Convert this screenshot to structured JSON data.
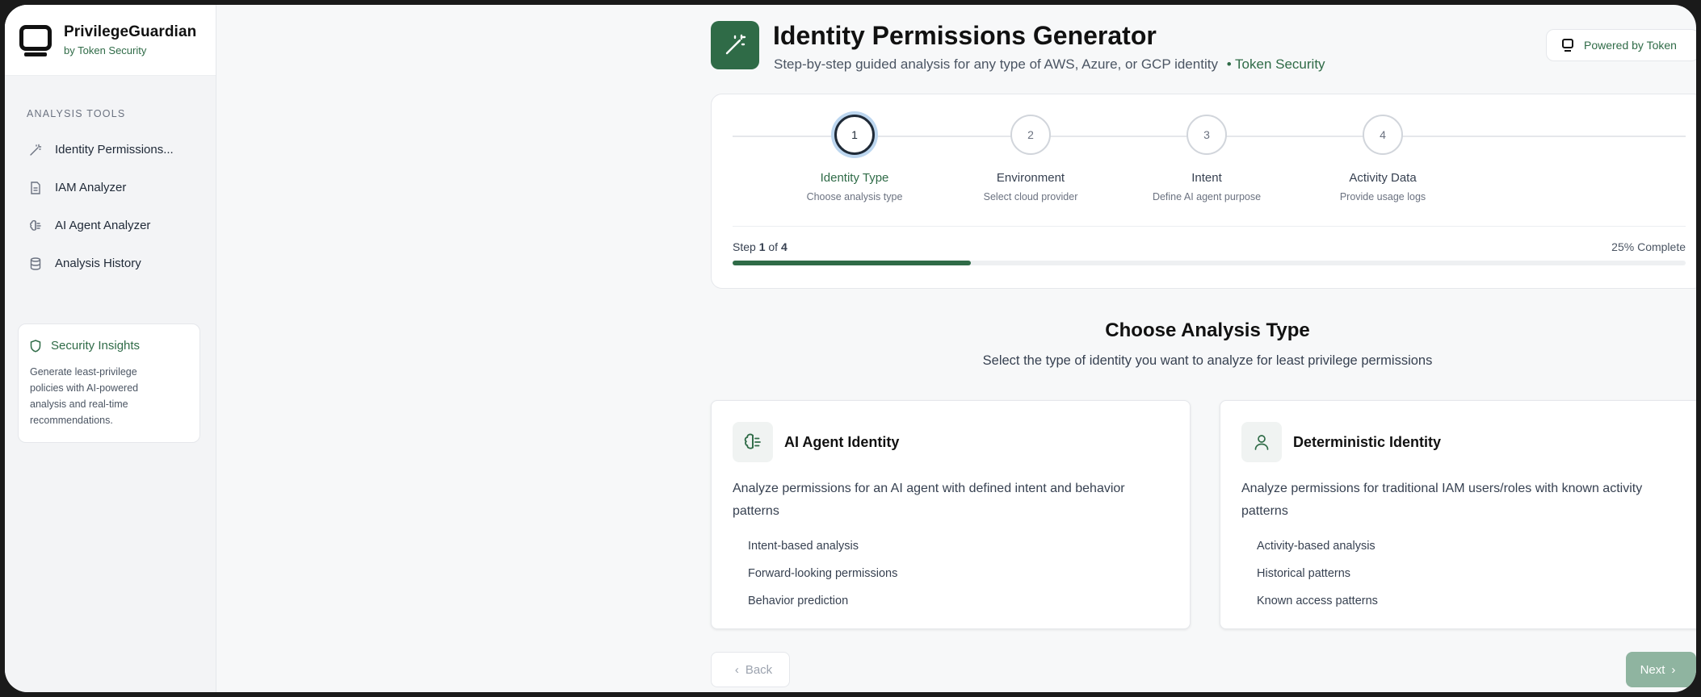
{
  "brand": {
    "name": "PrivilegeGuardian",
    "subtitle": "by Token Security"
  },
  "sidebar": {
    "section_label": "ANALYSIS TOOLS",
    "items": [
      {
        "label": "Identity Permissions...",
        "icon": "wand-icon"
      },
      {
        "label": "IAM Analyzer",
        "icon": "document-icon"
      },
      {
        "label": "AI Agent Analyzer",
        "icon": "brain-icon"
      },
      {
        "label": "Analysis History",
        "icon": "database-icon"
      }
    ],
    "insights": {
      "title": "Security Insights",
      "description": "Generate least-privilege policies with AI-powered analysis and real-time recommendations."
    }
  },
  "header": {
    "title": "Identity Permissions Generator",
    "subtitle": "Step-by-step guided analysis for any type of AWS, Azure, or GCP identity",
    "subtitle_accent": "• Token Security",
    "powered_by": "Powered by Token"
  },
  "stepper": {
    "steps": [
      {
        "number": "1",
        "label": "Identity Type",
        "description": "Choose analysis type",
        "active": true
      },
      {
        "number": "2",
        "label": "Environment",
        "description": "Select cloud provider",
        "active": false
      },
      {
        "number": "3",
        "label": "Intent",
        "description": "Define AI agent purpose",
        "active": false
      },
      {
        "number": "4",
        "label": "Activity Data",
        "description": "Provide usage logs",
        "active": false
      }
    ],
    "progress_prefix": "Step ",
    "current_step": "1",
    "progress_of": " of ",
    "total_steps": "4",
    "percent_text": "25% Complete",
    "percent_value": 25
  },
  "choose": {
    "title": "Choose Analysis Type",
    "subtitle": "Select the type of identity you want to analyze for least privilege permissions"
  },
  "cards": [
    {
      "title": "AI Agent Identity",
      "icon": "brain-icon",
      "description": "Analyze permissions for an AI agent with defined intent and behavior patterns",
      "features": [
        "Intent-based analysis",
        "Forward-looking permissions",
        "Behavior prediction"
      ]
    },
    {
      "title": "Deterministic Identity",
      "icon": "user-icon",
      "description": "Analyze permissions for traditional IAM users/roles with known activity patterns",
      "features": [
        "Activity-based analysis",
        "Historical patterns",
        "Known access patterns"
      ]
    }
  ],
  "buttons": {
    "back": "Back",
    "next": "Next"
  },
  "colors": {
    "accent": "#2f6b47",
    "next_disabled": "#8fb4a0",
    "active_ring": "#bcd6ef"
  }
}
